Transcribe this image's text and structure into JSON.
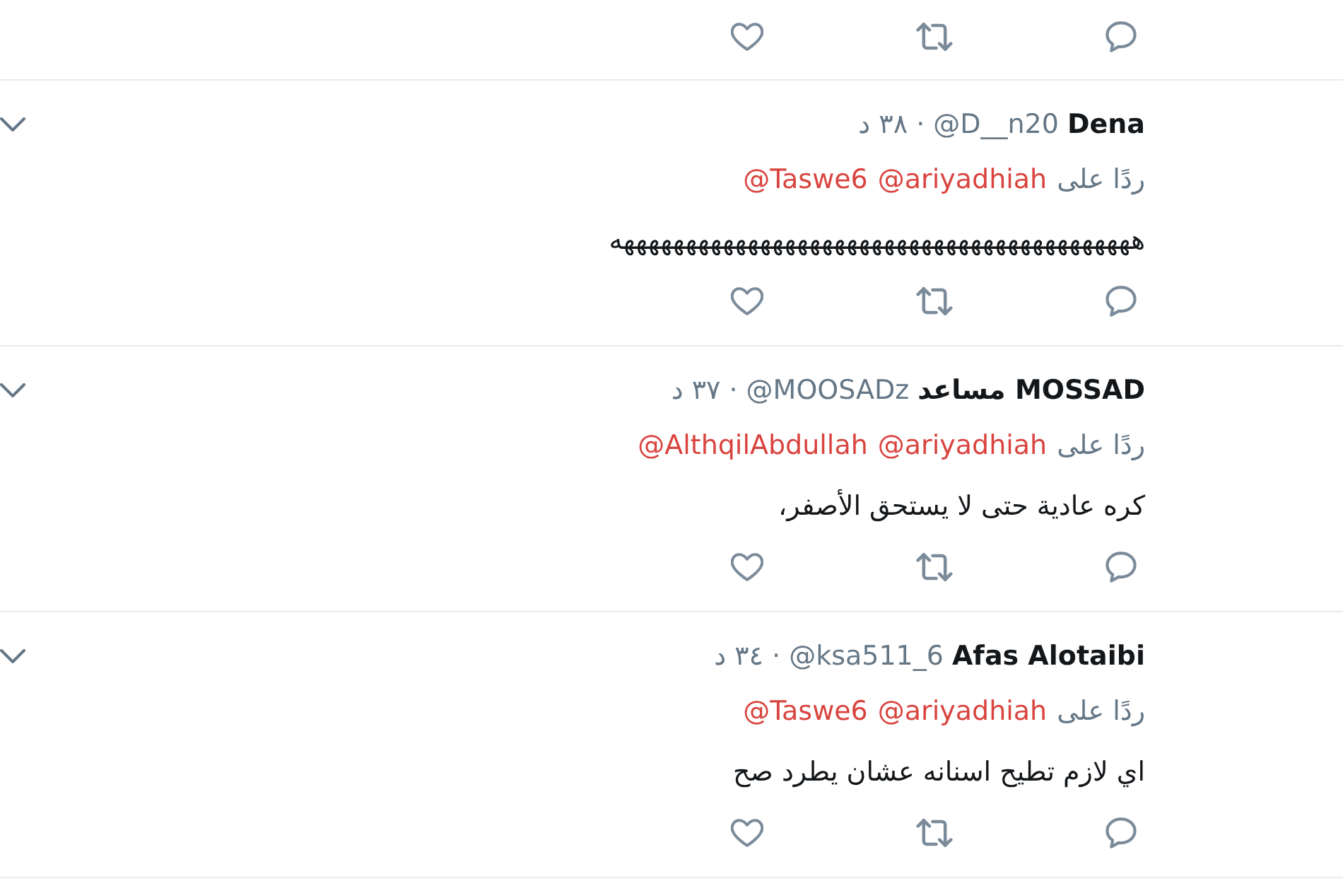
{
  "tweets": [
    {
      "kind": "cut_off"
    },
    {
      "kind": "reply",
      "name": "Dena",
      "handle": "@D__n20",
      "separator": "·",
      "time": "٣٨ د",
      "reply_label": "ردًا على",
      "mentions": [
        "@ariyadhiah",
        "@Taswe6"
      ],
      "text": "ههههههههههههههههههههههههههههههههههههههههههه"
    },
    {
      "kind": "reply",
      "name": "MOSSAD مساعد",
      "handle": "@MOOSADz",
      "separator": "·",
      "time": "٣٧ د",
      "reply_label": "ردًا على",
      "mentions": [
        "@ariyadhiah",
        "@AlthqilAbdullah"
      ],
      "text": "كره عادية حتى لا يستحق الأصفر،"
    },
    {
      "kind": "reply",
      "name": "Afas Alotaibi",
      "handle": "@ksa511_6",
      "separator": "·",
      "time": "٣٤ د",
      "reply_label": "ردًا على",
      "mentions": [
        "@ariyadhiah",
        "@Taswe6"
      ],
      "text": "اي لازم تطيح اسنانه عشان يطرد صح"
    }
  ]
}
